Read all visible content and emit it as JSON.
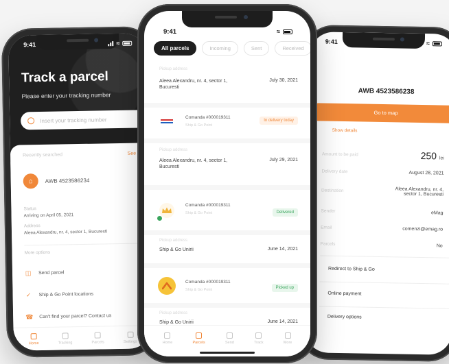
{
  "left_phone": {
    "status_time": "9:41",
    "title": "Track a parcel",
    "subtitle": "Please enter your tracking number",
    "search_placeholder": "Insert your tracking number",
    "recent_label": "Recently searched",
    "see_all": "See all",
    "awb_label": "AWB 4523586234",
    "status_label": "Status",
    "arriving_text": "Arriving on April 05, 2021",
    "address_label": "Address",
    "address_text": "Aleea Alexandru, nr. 4, sector 1, Bucuresti",
    "more_label": "More options",
    "menu": [
      {
        "label": "Send parcel",
        "icon": "parcel-icon"
      },
      {
        "label": "Ship & Go Point locations",
        "icon": "location-icon"
      },
      {
        "label": "Can't find your parcel? Contact us",
        "icon": "help-icon"
      }
    ],
    "tabs": [
      "Home",
      "Tracking",
      "Parcels",
      "Settings"
    ]
  },
  "center_phone": {
    "status_time": "9:41",
    "filter_tabs": [
      "All parcels",
      "Incoming",
      "Sent",
      "Received"
    ],
    "feed": [
      {
        "type": "address",
        "muted": "Pickup address",
        "text": "Aleea Alexandru, nr. 4, sector 1, Bucuresti",
        "date": "July 30, 2021"
      },
      {
        "type": "order",
        "logo": "emag",
        "title": "Comanda #000019311",
        "sub": "Ship & Go Point",
        "badge": "In delivery today",
        "badge_color": "orange"
      },
      {
        "type": "address",
        "muted": "Pickup address",
        "text": "Aleea Alexandru, nr. 4, sector 1, Bucuresti",
        "date": "July 29, 2021"
      },
      {
        "type": "order",
        "logo": "crown",
        "title": "Comanda #000019311",
        "sub": "Ship & Go Point",
        "badge": "Delivered",
        "badge_color": "green"
      },
      {
        "type": "address",
        "muted": "Pickup address",
        "text": "Ship & Go Unirii",
        "date": "June 14, 2021"
      },
      {
        "type": "order",
        "logo": "arrow",
        "title": "Comanda #000019311",
        "sub": "Ship & Go Point",
        "badge": "Picked up",
        "badge_color": "green"
      },
      {
        "type": "address",
        "muted": "Pickup address",
        "text": "Ship & Go Unirii",
        "date": "June 14, 2021"
      }
    ],
    "tabs": [
      "Home",
      "Parcels",
      "Send",
      "Track",
      "More"
    ],
    "active_tab": 1
  },
  "right_phone": {
    "status_time": "9:41",
    "awb_title": "AWB 4523586238",
    "goto_button": "Go to map",
    "show_details": "Show details",
    "details": [
      {
        "key": "Amount to be paid",
        "value": "250",
        "unit": "lei"
      },
      {
        "key": "Delivery date",
        "value": "August 28, 2021"
      },
      {
        "key": "Destination",
        "value": "Aleea Alexandru, nr. 4, sector 1, Bucuresti"
      },
      {
        "key": "Sender",
        "value": "eMag"
      },
      {
        "key": "Email",
        "value": "comenzi@emag.ro"
      },
      {
        "key": "Parcels",
        "value": "No"
      }
    ],
    "links": [
      "Redirect to Ship & Go",
      "Online payment",
      "Delivery options"
    ]
  },
  "colors": {
    "accent": "#f28a3a",
    "dark_header": "#1f1f1f",
    "success": "#3aa55d"
  }
}
